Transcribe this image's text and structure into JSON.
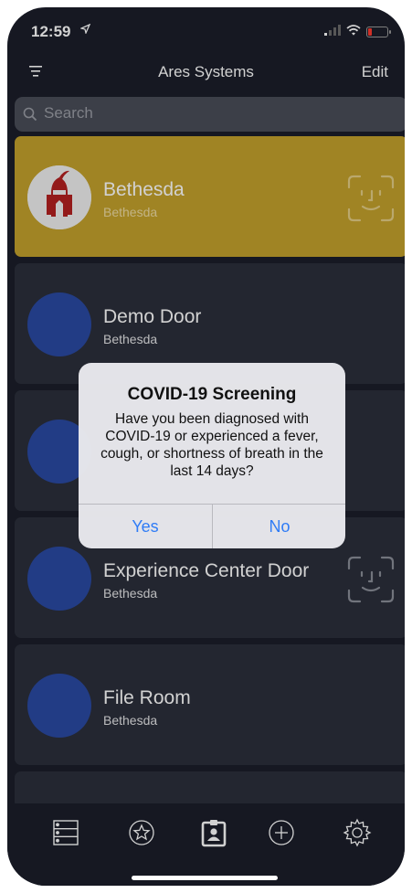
{
  "status_bar": {
    "time": "12:59",
    "location_icon": "location-arrow-icon",
    "signal_icon": "signal-icon",
    "wifi_icon": "wifi-icon",
    "battery_icon": "battery-low-icon"
  },
  "nav": {
    "title": "Ares Systems",
    "edit_label": "Edit",
    "filter_icon": "filter-icon"
  },
  "search": {
    "placeholder": "Search",
    "value": ""
  },
  "doors": [
    {
      "title": "Bethesda",
      "subtitle": "Bethesda",
      "selected": true,
      "avatar": "ares-logo",
      "face_id": true
    },
    {
      "title": "Demo Door",
      "subtitle": "Bethesda",
      "selected": false,
      "avatar": "blue-circle",
      "face_id": false
    },
    {
      "title": "",
      "subtitle": "",
      "selected": false,
      "avatar": "blue-circle",
      "face_id": false
    },
    {
      "title": "Experience Center Door",
      "subtitle": "Bethesda",
      "selected": false,
      "avatar": "blue-circle",
      "face_id": true
    },
    {
      "title": "File Room",
      "subtitle": "Bethesda",
      "selected": false,
      "avatar": "blue-circle",
      "face_id": false
    }
  ],
  "tabs": [
    {
      "icon": "list-icon",
      "active": false
    },
    {
      "icon": "star-icon",
      "active": false
    },
    {
      "icon": "badge-icon",
      "active": true
    },
    {
      "icon": "add-icon",
      "active": false
    },
    {
      "icon": "settings-icon",
      "active": false
    }
  ],
  "alert": {
    "title": "COVID-19 Screening",
    "message": "Have you been diagnosed with COVID-19 or experienced a fever, cough, or shortness of breath in the last 14 days?",
    "yes_label": "Yes",
    "no_label": "No"
  },
  "colors": {
    "background": "#1b1e2a",
    "card": "#2b2f3b",
    "selected_card": "#c4a12c",
    "avatar_blue": "#2a4aa3",
    "alert_button": "#2f7cf6"
  }
}
